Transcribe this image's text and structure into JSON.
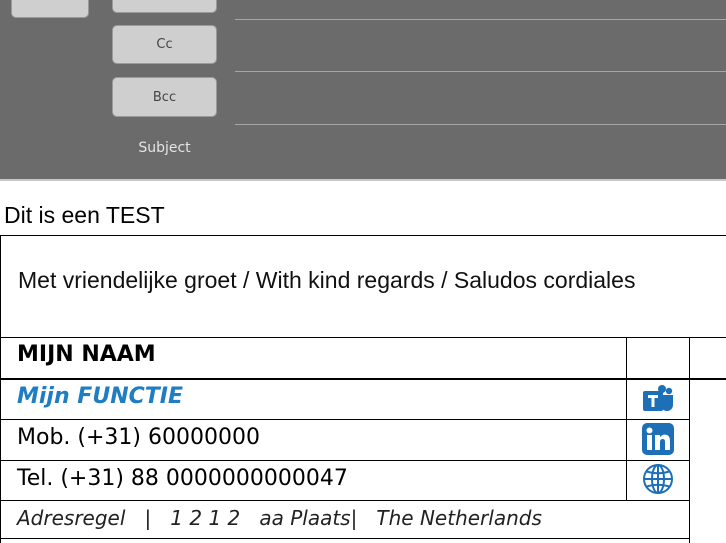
{
  "compose": {
    "cc_label": "Cc",
    "bcc_label": "Bcc",
    "subject_label": "Subject"
  },
  "body": {
    "text": "Dit is een TEST"
  },
  "signature": {
    "greeting": "Met vriendelijke groet / With kind regards / Saludos cordiales",
    "name": "MIJN NAAM",
    "function": "Mijn FUNCTIE",
    "mobile": "Mob. (+31) 60000000",
    "telephone": "Tel. (+31) 88 0000000000047",
    "address": "Adresregel   |   1 2 1 2   aa Plaats|   The Netherlands",
    "icons": [
      "teams-icon",
      "linkedin-icon",
      "globe-icon"
    ],
    "function_color": "#1f7dc4",
    "icon_color": "#1d6fb8"
  }
}
